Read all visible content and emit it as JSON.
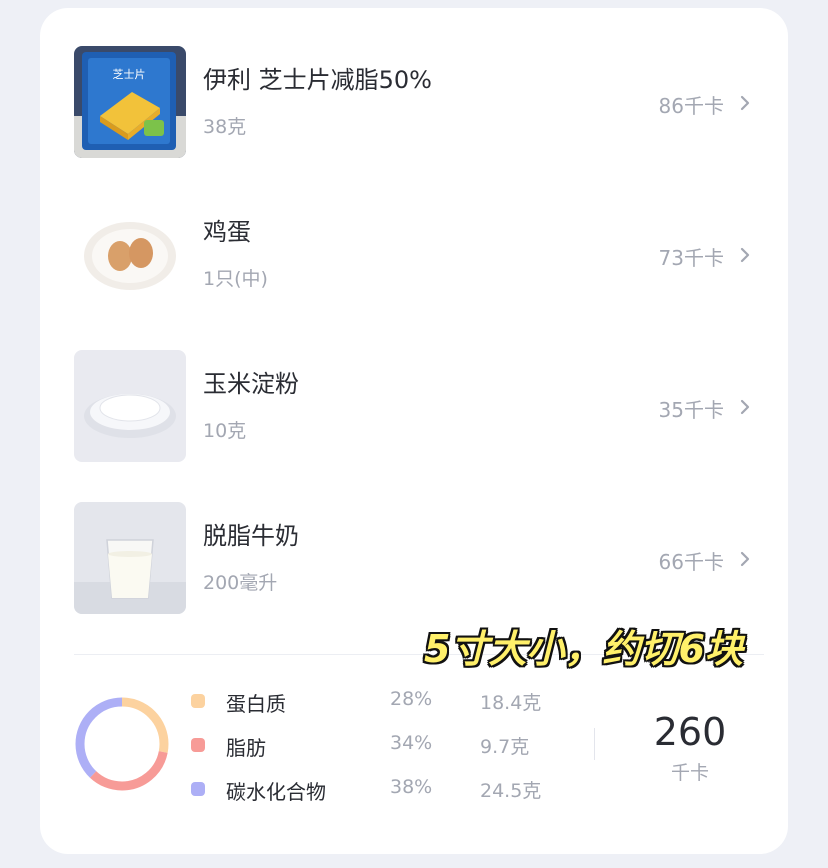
{
  "foods": [
    {
      "name": "伊利 芝士片减脂50%",
      "amount": "38克",
      "kcal": "86千卡",
      "image": "cheese-slice-package",
      "package_text": "芝士片"
    },
    {
      "name": "鸡蛋",
      "amount": "1只(中)",
      "kcal": "73千卡",
      "image": "eggs-on-plate"
    },
    {
      "name": "玉米淀粉",
      "amount": "10克",
      "kcal": "35千卡",
      "image": "corn-starch-bowl"
    },
    {
      "name": "脱脂牛奶",
      "amount": "200毫升",
      "kcal": "66千卡",
      "image": "milk-glass"
    }
  ],
  "macros": [
    {
      "name": "蛋白质",
      "percent": "28%",
      "grams": "18.4克",
      "fraction": 0.28,
      "color": "#fcd29f"
    },
    {
      "name": "脂肪",
      "percent": "34%",
      "grams": "9.7克",
      "fraction": 0.34,
      "color": "#f79b97"
    },
    {
      "name": "碳水化合物",
      "percent": "38%",
      "grams": "24.5克",
      "fraction": 0.38,
      "color": "#adaff6"
    }
  ],
  "total": {
    "value": "260",
    "unit": "千卡"
  },
  "overlay_text": "5寸大小，约切6块",
  "icons": {
    "row_arrow": "chevron-right-icon"
  }
}
